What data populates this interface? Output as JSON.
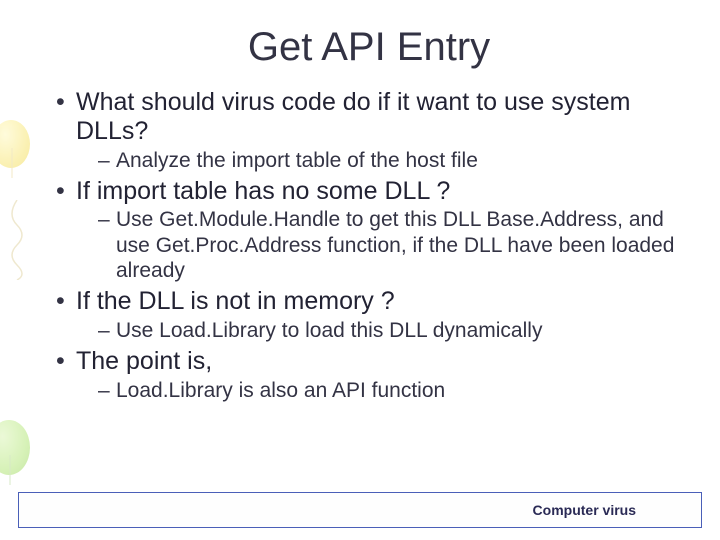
{
  "title": "Get API Entry",
  "bullets": [
    {
      "text": "What should virus code do if it want to use system DLLs?",
      "subs": [
        "Analyze the import table of the host file"
      ]
    },
    {
      "text": "If import table has no some DLL ?",
      "subs": [
        "Use Get.Module.Handle to get this DLL Base.Address, and use Get.Proc.Address function, if the DLL have been loaded already"
      ]
    },
    {
      "text": "If the DLL is not in memory ?",
      "subs": [
        "Use Load.Library to load this DLL dynamically"
      ]
    },
    {
      "text": "The point is,",
      "subs": [
        "Load.Library is also an API function"
      ]
    }
  ],
  "footer": {
    "label": "Computer virus"
  }
}
